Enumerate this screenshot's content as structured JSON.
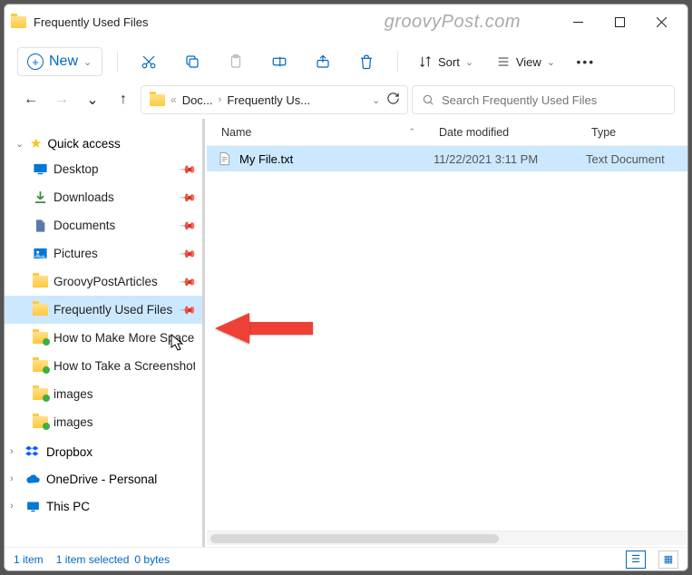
{
  "watermark": "groovyPost.com",
  "window": {
    "title": "Frequently Used Files"
  },
  "toolbar": {
    "new_label": "New",
    "sort_label": "Sort",
    "view_label": "View"
  },
  "breadcrumb": {
    "seg1": "Doc...",
    "seg2": "Frequently Us..."
  },
  "search": {
    "placeholder": "Search Frequently Used Files"
  },
  "sidebar": {
    "quick_access": "Quick access",
    "items": [
      {
        "label": "Desktop",
        "icon": "desktop",
        "pinned": true
      },
      {
        "label": "Downloads",
        "icon": "download",
        "pinned": true
      },
      {
        "label": "Documents",
        "icon": "document",
        "pinned": true
      },
      {
        "label": "Pictures",
        "icon": "pictures",
        "pinned": true
      },
      {
        "label": "GroovyPostArticles",
        "icon": "folder",
        "pinned": true
      },
      {
        "label": "Frequently Used Files",
        "icon": "folder",
        "pinned": true,
        "selected": true
      },
      {
        "label": "How to Make More Space Av",
        "icon": "folder-shared"
      },
      {
        "label": "How to Take a Screenshot on",
        "icon": "folder-shared"
      },
      {
        "label": "images",
        "icon": "folder-shared"
      },
      {
        "label": "images",
        "icon": "folder-shared"
      }
    ],
    "dropbox": "Dropbox",
    "onedrive": "OneDrive - Personal",
    "thispc": "This PC"
  },
  "columns": {
    "name": "Name",
    "date": "Date modified",
    "type": "Type"
  },
  "rows": [
    {
      "name": "My File.txt",
      "date": "11/22/2021 3:11 PM",
      "type": "Text Document",
      "selected": true
    }
  ],
  "status": {
    "count": "1 item",
    "selection": "1 item selected",
    "size": "0 bytes"
  }
}
